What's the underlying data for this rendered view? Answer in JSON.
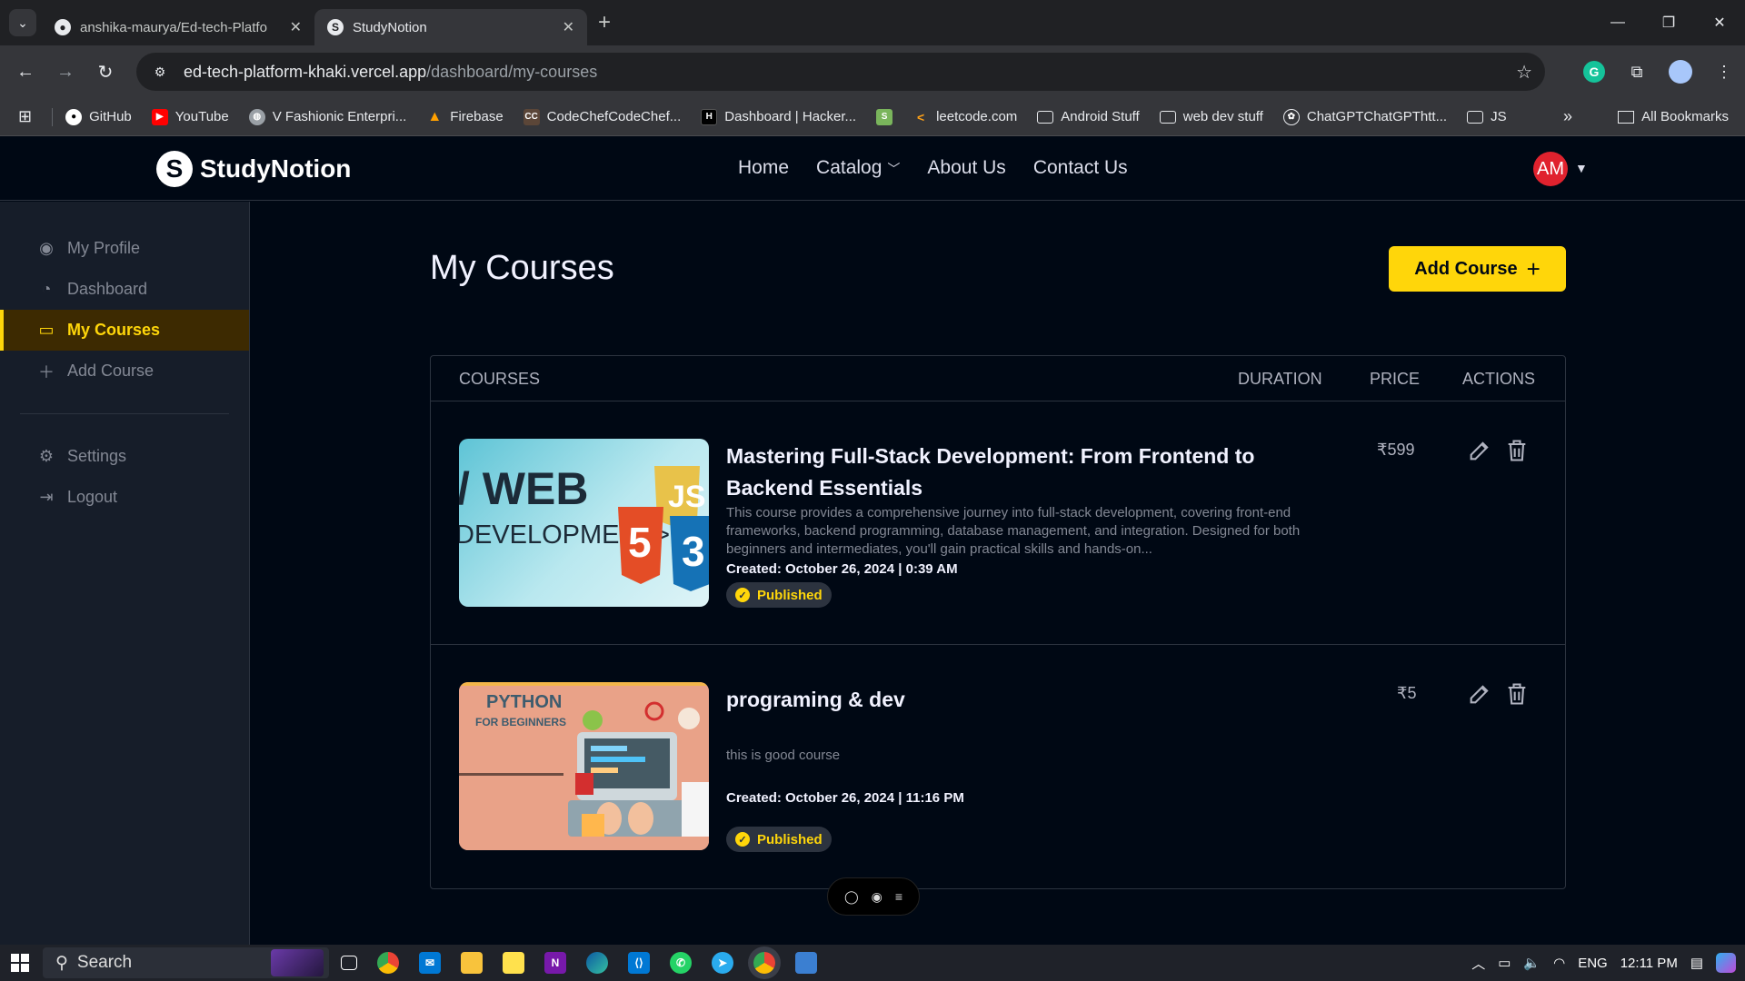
{
  "browser": {
    "tabs": [
      {
        "title": "anshika-maurya/Ed-tech-Platfo",
        "favicon": "github-icon",
        "active": false
      },
      {
        "title": "StudyNotion",
        "favicon": "studynotion-icon",
        "active": true
      }
    ],
    "url_host": "ed-tech-platform-khaki.vercel.app",
    "url_path": "/dashboard/my-courses",
    "bookmarks": [
      {
        "label": "GitHub",
        "icon": "github-icon",
        "color": "#ffffff"
      },
      {
        "label": "YouTube",
        "icon": "youtube-icon",
        "color": "#ff0000"
      },
      {
        "label": "V Fashionic Enterpri...",
        "icon": "globe-icon",
        "color": "#9aa0a6"
      },
      {
        "label": "Firebase",
        "icon": "firebase-icon",
        "color": "#ffa000"
      },
      {
        "label": "CodeChefCodeChef...",
        "icon": "codechef-icon",
        "color": "#5b4638"
      },
      {
        "label": "Dashboard | Hacker...",
        "icon": "hackerrank-icon",
        "color": "#000000"
      },
      {
        "label": "",
        "icon": "shopify-icon",
        "color": "#7ab55c"
      },
      {
        "label": "leetcode.com",
        "icon": "leetcode-icon",
        "color": "#ffa116"
      },
      {
        "label": "Android Stuff",
        "icon": "folder-icon",
        "color": "#e8eaed"
      },
      {
        "label": "web dev stuff",
        "icon": "folder-icon",
        "color": "#e8eaed"
      },
      {
        "label": "ChatGPTChatGPThtt...",
        "icon": "openai-icon",
        "color": "#e8eaed"
      },
      {
        "label": "JS",
        "icon": "folder-icon",
        "color": "#e8eaed"
      }
    ],
    "all_bookmarks": "All Bookmarks"
  },
  "app": {
    "brand": "StudyNotion",
    "nav": [
      "Home",
      "Catalog",
      "About Us",
      "Contact Us"
    ],
    "avatar_initials": "AM"
  },
  "sidebar": {
    "items": [
      {
        "label": "My Profile",
        "icon": "user-circle-icon",
        "active": false
      },
      {
        "label": "Dashboard",
        "icon": "gauge-icon",
        "active": false
      },
      {
        "label": "My Courses",
        "icon": "monitor-icon",
        "active": true
      },
      {
        "label": "Add Course",
        "icon": "plus-icon",
        "active": false
      }
    ],
    "bottom": [
      {
        "label": "Settings",
        "icon": "gear-icon"
      },
      {
        "label": "Logout",
        "icon": "logout-icon"
      }
    ]
  },
  "main": {
    "title": "My Courses",
    "add_button": "Add Course",
    "columns": [
      "COURSES",
      "DURATION",
      "PRICE",
      "ACTIONS"
    ],
    "courses": [
      {
        "title": "Mastering Full-Stack Development: From Frontend to Backend Essentials",
        "description": "This course provides a comprehensive journey into full-stack development, covering front-end frameworks, backend programming, database management, and integration. Designed for both beginners and intermediates, you'll gain practical skills and hands-on...",
        "created": "Created: October 26, 2024 | 0:39 AM",
        "status": "Published",
        "price": "₹599",
        "thumb_text_1": "/ WEB",
        "thumb_text_2": "DEVELOPMENT>"
      },
      {
        "title": "programing & dev",
        "description": "this is good course",
        "created": "Created: October 26, 2024 | 11:16 PM",
        "status": "Published",
        "price": "₹5",
        "thumb_text_1": "PYTHON",
        "thumb_text_2": "FOR BEGINNERS"
      }
    ]
  },
  "taskbar": {
    "search": "Search",
    "lang": "ENG",
    "time": "12:11 PM"
  },
  "colors": {
    "accent": "#FFD60A",
    "bg": "#000814",
    "sidebar": "#161D29",
    "border": "#2C333F"
  }
}
